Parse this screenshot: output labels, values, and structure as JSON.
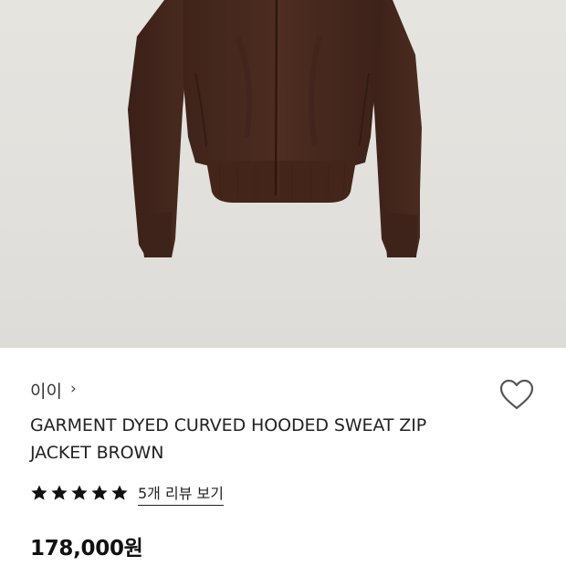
{
  "product": {
    "brand": "이이",
    "title": "GARMENT DYED CURVED HOODED SWEAT ZIP JACKET BROWN",
    "rating_stars": 5,
    "review_link": "5개 리뷰 보기",
    "price": "178,000원"
  },
  "colors": {
    "garment": "#4a2a20",
    "background": "#e3e1dd",
    "star": "#111111"
  },
  "icons": {
    "brand_chevron": "chevron-right-icon",
    "wishlist": "heart-outline-icon",
    "rating": "star-icon"
  }
}
